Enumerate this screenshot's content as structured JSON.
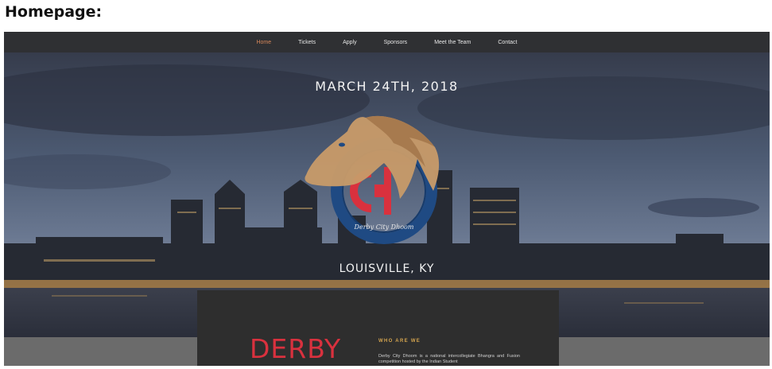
{
  "page_heading": "Homepage:",
  "nav": {
    "items": [
      "Home",
      "Tickets",
      "Apply",
      "Sponsors",
      "Meet the Team",
      "Contact"
    ],
    "active_index": 0
  },
  "hero": {
    "date": "MARCH 24TH, 2018",
    "city": "LOUISVILLE, KY",
    "logo_text": "Derby City Dhoom",
    "logo_letters": "dc"
  },
  "about": {
    "title": "DERBY",
    "heading": "WHO ARE WE",
    "text": "Derby City Dhoom is a national intercollegiate Bhangra and Fusion competition hosted by the Indian Student"
  },
  "colors": {
    "nav_active": "#d7875a",
    "derby_red": "#d9313e",
    "heading_gold": "#d4a44f",
    "logo_blue": "#1f4a83",
    "logo_horse": "#c79a69"
  }
}
